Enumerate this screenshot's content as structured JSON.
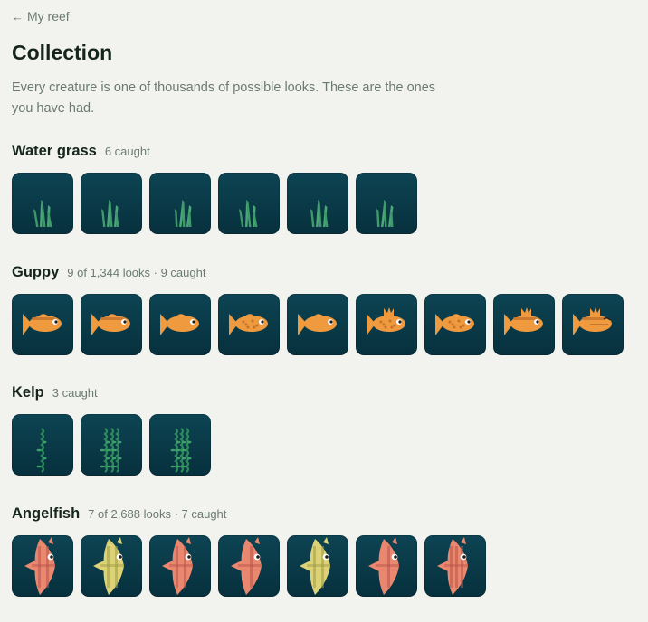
{
  "nav": {
    "back_label": "My reef",
    "back_icon": "arrow-left-icon"
  },
  "page": {
    "title": "Collection",
    "description": "Every creature is one of thousands of possible looks. These are the ones you have had."
  },
  "colors": {
    "background": "#f2f3ef",
    "tile": "#0b3d4b",
    "grass": "#3f9a6a",
    "kelp": "#2e8a5c",
    "guppy": "#ef9a3f",
    "angel_coral": "#e9876f",
    "angel_yellow": "#ddd276"
  },
  "sections": [
    {
      "title": "Water grass",
      "meta": "6 caught",
      "kind": "grass",
      "items": [
        {
          "v": 0
        },
        {
          "v": 1
        },
        {
          "v": 2
        },
        {
          "v": 3
        },
        {
          "v": 4
        },
        {
          "v": 5
        }
      ]
    },
    {
      "title": "Guppy",
      "meta": "9 of 1,344 looks · 9 caught",
      "kind": "guppy",
      "items": [
        {
          "spots": false,
          "crest": false,
          "stripe": true
        },
        {
          "spots": false,
          "crest": false,
          "stripe": true
        },
        {
          "spots": false,
          "crest": false,
          "stripe": false
        },
        {
          "spots": true,
          "crest": false,
          "stripe": false
        },
        {
          "spots": false,
          "crest": false,
          "stripe": false
        },
        {
          "spots": true,
          "crest": true,
          "stripe": false
        },
        {
          "spots": true,
          "crest": false,
          "stripe": false
        },
        {
          "spots": false,
          "crest": true,
          "stripe": true
        },
        {
          "spots": false,
          "crest": true,
          "stripe": true,
          "sleepy": true
        }
      ]
    },
    {
      "title": "Kelp",
      "meta": "3 caught",
      "kind": "kelp",
      "items": [
        {
          "v": 0
        },
        {
          "v": 1
        },
        {
          "v": 2
        }
      ]
    },
    {
      "title": "Angelfish",
      "meta": "7 of 2,688 looks · 7 caught",
      "kind": "angel",
      "items": [
        {
          "color": "coral",
          "stripes": 2
        },
        {
          "color": "yellow",
          "stripes": 2
        },
        {
          "color": "coral",
          "stripes": 2
        },
        {
          "color": "coral",
          "stripes": 1
        },
        {
          "color": "yellow",
          "stripes": 2
        },
        {
          "color": "coral",
          "stripes": 1
        },
        {
          "color": "coral",
          "stripes": 3
        }
      ]
    }
  ]
}
